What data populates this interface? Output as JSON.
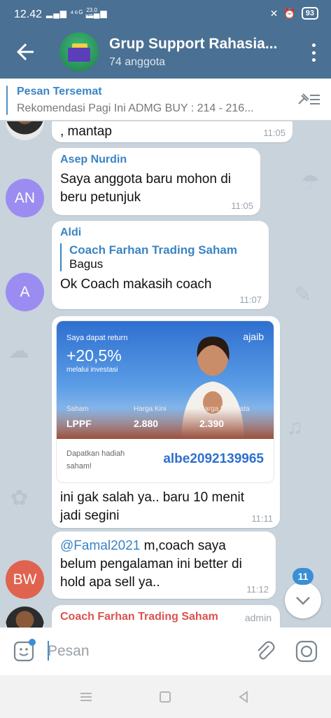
{
  "status_bar": {
    "time": "12.42",
    "network": "⁴⁶ᴳ",
    "speed_value": "23.0",
    "speed_unit": "KB/S",
    "battery": "93"
  },
  "header": {
    "title": "Grup Support Rahasia...",
    "subtitle": "74 anggota"
  },
  "pinned": {
    "title": "Pesan Tersemat",
    "text": "Rekomendasi Pagi Ini  ADMG BUY : 214 - 216..."
  },
  "messages": [
    {
      "text": ", mantap",
      "time": "11:05"
    },
    {
      "sender": "Asep Nurdin",
      "sender_color": "#3a84c4",
      "avatar_initials": "AN",
      "avatar_color": "#9b8cf2",
      "text": "Saya anggota baru mohon di beru petunjuk",
      "time": "11:05"
    },
    {
      "sender": "Aldi",
      "sender_color": "#3a84c4",
      "avatar_initials": "A",
      "avatar_color": "#9b8cf2",
      "reply_name": "Coach Farhan Trading Saham",
      "reply_text": "Bagus",
      "text": "Ok Coach makasih coach",
      "time": "11:07"
    },
    {
      "ad": {
        "brand": "ajaib",
        "line1": "Saya dapat return",
        "percent": "+20,5%",
        "line2": "melalui investasi",
        "label_saham": "Saham",
        "label_harga_kini": "Harga Kini",
        "label_harga_rata": "Harga Rata-rata",
        "saham": "LPPF",
        "harga_kini": "2.880",
        "harga_rata": "2.390",
        "gift": "Dapatkan hadiah saham!",
        "code": "albe2092139965"
      },
      "text": "ini gak salah ya.. baru 10 menit jadi segini",
      "time": "11:11"
    },
    {
      "avatar_initials": "BW",
      "avatar_color": "#e0634f",
      "mention": "@Famal2021",
      "text": " m,coach saya belum pengalaman ini better di hold apa sell ya..",
      "time": "11:12"
    },
    {
      "sender": "Coach Farhan Trading Saham",
      "sender_color": "#d9534f",
      "role": "admin"
    }
  ],
  "scroll_badge": "11",
  "input": {
    "placeholder": "Pesan"
  },
  "colors": {
    "header": "#4a7093",
    "accent": "#3a84c4"
  }
}
